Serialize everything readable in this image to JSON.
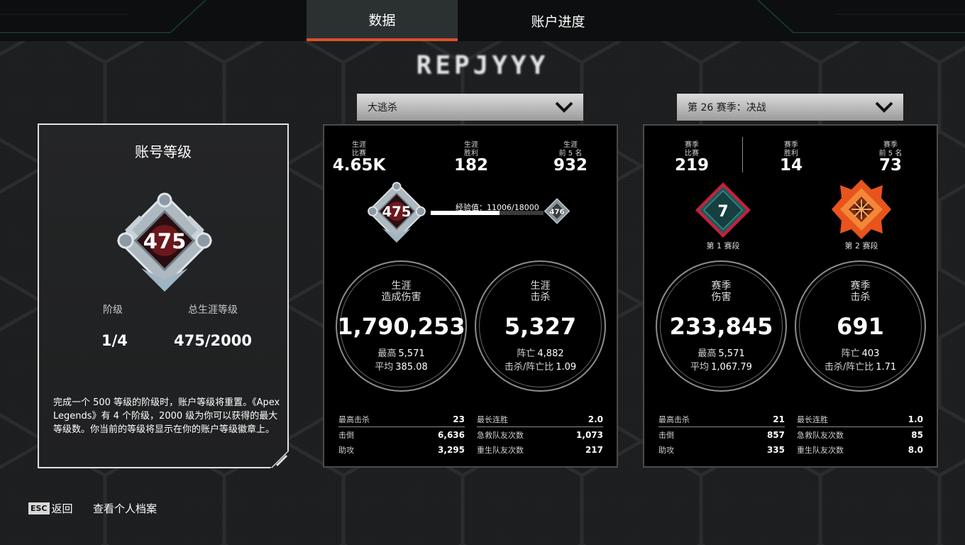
{
  "tabs": [
    {
      "label": "数据",
      "active": true
    },
    {
      "label": "账户进度",
      "active": false
    }
  ],
  "player_name": "REPJYYY",
  "dropdowns": {
    "mode": "大逃杀",
    "season": "第 26 赛季：决战"
  },
  "account": {
    "title": "账号等级",
    "badge_level": "475",
    "tier_label": "阶级",
    "tier_value": "1/4",
    "career_label": "总生涯等级",
    "career_value": "475/2000",
    "description": "完成一个 500 等级的阶级时，账户等级将重置。《Apex Legends》有 4 个阶级，2000 级为你可以获得的最大等级数。你当前的等级将显示在你的账户等级徽章上。"
  },
  "career": {
    "header": [
      {
        "label1": "生涯",
        "label2": "比赛",
        "value": "4.65K"
      },
      {
        "label1": "生涯",
        "label2": "胜利",
        "value": "182"
      },
      {
        "label1": "生涯",
        "label2": "前 5 名",
        "value": "932"
      }
    ],
    "level_badge": "475",
    "next_level_badge": "476",
    "xp_text": "经验值：11006/18000",
    "xp_progress": 0.611,
    "damage": {
      "label1": "生涯",
      "label2": "造成伤害",
      "value": "1,790,253",
      "sub1_label": "最高",
      "sub1_value": "5,571",
      "sub2_label": "平均",
      "sub2_value": "385.08"
    },
    "kills": {
      "label1": "生涯",
      "label2": "击杀",
      "value": "5,327",
      "sub1_label": "阵亡",
      "sub1_value": "4,882",
      "sub2_label": "击杀/阵亡比",
      "sub2_value": "1.09"
    },
    "table_left": [
      {
        "label": "最高击杀",
        "value": "23"
      },
      {
        "label": "击倒",
        "value": "6,636"
      },
      {
        "label": "助攻",
        "value": "3,295"
      }
    ],
    "table_right": [
      {
        "label": "最长连胜",
        "value": "2.0"
      },
      {
        "label": "急救队友次数",
        "value": "1,073"
      },
      {
        "label": "重生队友次数",
        "value": "217"
      }
    ]
  },
  "season": {
    "header": [
      {
        "label1": "赛季",
        "label2": "比赛",
        "value": "219"
      },
      {
        "label1": "赛季",
        "label2": "胜利",
        "value": "14"
      },
      {
        "label1": "赛季",
        "label2": "前 5 名",
        "value": "73"
      }
    ],
    "split1_rank": "7",
    "split1_label": "第 1 赛段",
    "split2_label": "第 2 赛段",
    "damage": {
      "label1": "赛季",
      "label2": "伤害",
      "value": "233,845",
      "sub1_label": "最高",
      "sub1_value": "5,571",
      "sub2_label": "平均",
      "sub2_value": "1,067.79"
    },
    "kills": {
      "label1": "赛季",
      "label2": "击杀",
      "value": "691",
      "sub1_label": "阵亡",
      "sub1_value": "403",
      "sub2_label": "击杀/阵亡比",
      "sub2_value": "1.71"
    },
    "table_left": [
      {
        "label": "最高击杀",
        "value": "21"
      },
      {
        "label": "击倒",
        "value": "857"
      },
      {
        "label": "助攻",
        "value": "335"
      }
    ],
    "table_right": [
      {
        "label": "最长连胜",
        "value": "1.0"
      },
      {
        "label": "急救队友次数",
        "value": "85"
      },
      {
        "label": "重生队友次数",
        "value": "8.0"
      }
    ]
  },
  "footer": {
    "esc_key": "ESC",
    "back_label": "返回",
    "profile_label": "查看个人档案"
  },
  "colors": {
    "accent": "#e04e2b",
    "panel": "#000000",
    "rank_teal": "#1d5a5a",
    "rank_red": "#c8203c",
    "rank_orange": "#e8541c"
  }
}
